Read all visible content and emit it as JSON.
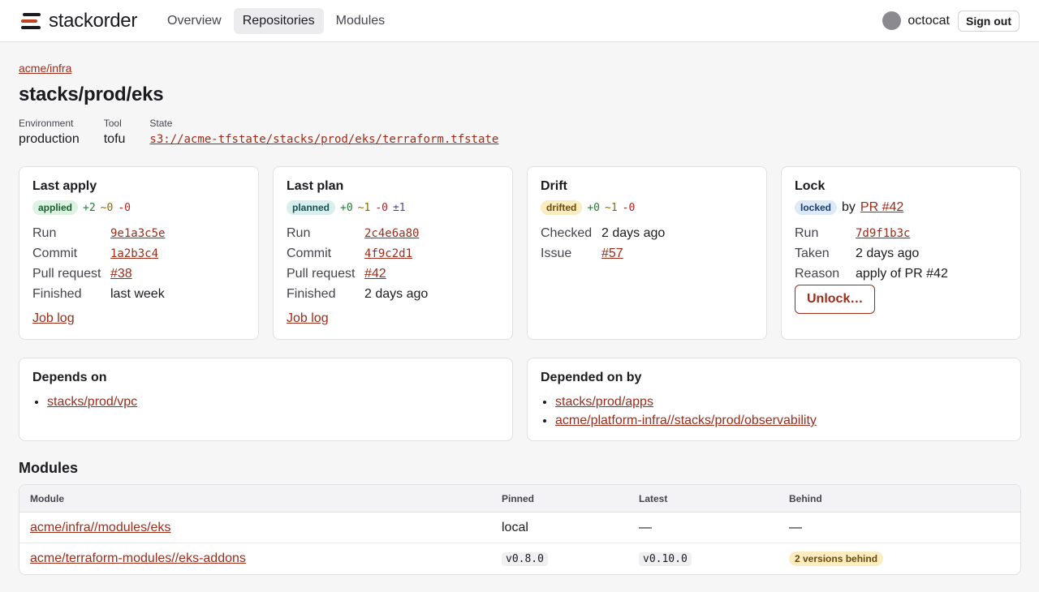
{
  "header": {
    "brand": "stackorder",
    "nav": [
      {
        "label": "Overview"
      },
      {
        "label": "Repositories"
      },
      {
        "label": "Modules"
      }
    ],
    "user": "octocat",
    "signout": "Sign out"
  },
  "breadcrumb": "acme/infra",
  "title": "stacks/prod/eks",
  "meta": {
    "environment_label": "Environment",
    "environment": "production",
    "tool_label": "Tool",
    "tool": "tofu",
    "state_label": "State",
    "state": "s3://acme-tfstate/stacks/prod/eks/terraform.tfstate"
  },
  "last_apply": {
    "title": "Last apply",
    "badge": "applied",
    "add": "+2",
    "change": "~0",
    "destroy": "-0",
    "run_label": "Run",
    "run": "9e1a3c5e",
    "commit_label": "Commit",
    "commit": "1a2b3c4",
    "pr_label": "Pull request",
    "pr": "#38",
    "finished_label": "Finished",
    "finished": "last week",
    "job_log": "Job log"
  },
  "last_plan": {
    "title": "Last plan",
    "badge": "planned",
    "add": "+0",
    "change": "~1",
    "destroy": "-0",
    "replace": "±1",
    "run_label": "Run",
    "run": "2c4e6a80",
    "commit_label": "Commit",
    "commit": "4f9c2d1",
    "pr_label": "Pull request",
    "pr": "#42",
    "finished_label": "Finished",
    "finished": "2 days ago",
    "job_log": "Job log"
  },
  "drift": {
    "title": "Drift",
    "badge": "drifted",
    "add": "+0",
    "change": "~1",
    "destroy": "-0",
    "checked_label": "Checked",
    "checked": "2 days ago",
    "issue_label": "Issue",
    "issue": "#57"
  },
  "lock": {
    "title": "Lock",
    "badge": "locked",
    "by": "by",
    "by_link": "PR #42",
    "run_label": "Run",
    "run": "7d9f1b3c",
    "taken_label": "Taken",
    "taken": "2 days ago",
    "reason_label": "Reason",
    "reason": "apply of PR #42",
    "unlock": "Unlock…"
  },
  "depends_on": {
    "title": "Depends on",
    "items": [
      "stacks/prod/vpc"
    ]
  },
  "depended_on_by": {
    "title": "Depended on by",
    "items": [
      "stacks/prod/apps",
      "acme/platform-infra//stacks/prod/observability"
    ]
  },
  "modules": {
    "title": "Modules",
    "columns": [
      "Module",
      "Pinned",
      "Latest",
      "Behind"
    ],
    "rows": [
      {
        "module": "acme/infra//modules/eks",
        "pinned": "local",
        "latest": "—",
        "behind": "—"
      },
      {
        "module": "acme/terraform-modules//eks-addons",
        "pinned": "v0.8.0",
        "latest": "v0.10.0",
        "behind": "2 versions behind"
      }
    ]
  },
  "colors": {
    "link": "#9b2c1a",
    "applied": "#dcf3e1",
    "planned": "#d9efef",
    "drifted": "#fbecc2",
    "locked": "#dde9f8"
  }
}
